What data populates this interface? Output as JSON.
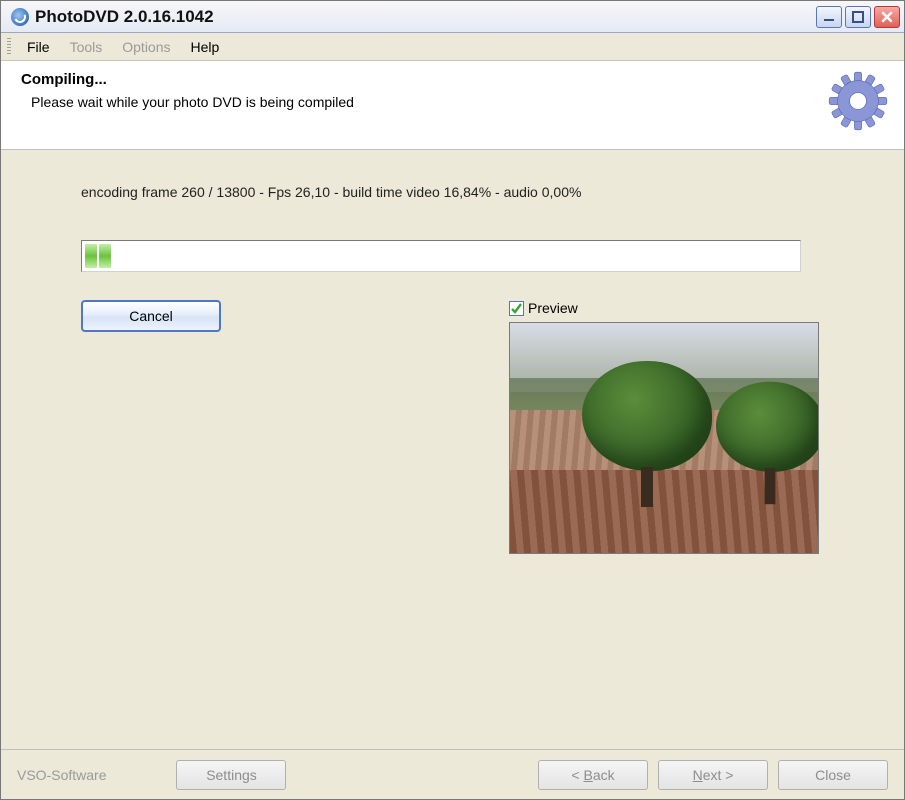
{
  "window": {
    "title": "PhotoDVD 2.0.16.1042"
  },
  "menu": {
    "file": "File",
    "tools": "Tools",
    "options": "Options",
    "help": "Help"
  },
  "header": {
    "title": "Compiling...",
    "subtitle": "Please wait while your photo DVD is being compiled"
  },
  "progress": {
    "status_text": "encoding frame 260 / 13800  - Fps 26,10  - build time video 16,84% - audio 0,00%",
    "current_frame": 260,
    "total_frames": 13800,
    "fps": "26,10",
    "build_time_video_pct": "16,84%",
    "audio_pct": "0,00%",
    "bar_chunks": 2
  },
  "buttons": {
    "cancel": "Cancel",
    "settings": "Settings",
    "back_prefix": "< ",
    "back_ul": "B",
    "back_suffix": "ack",
    "next_ul": "N",
    "next_suffix": "ext >",
    "close": "Close"
  },
  "preview": {
    "checkbox_checked": true,
    "label": "Preview"
  },
  "footer": {
    "brand": "VSO-Software"
  }
}
